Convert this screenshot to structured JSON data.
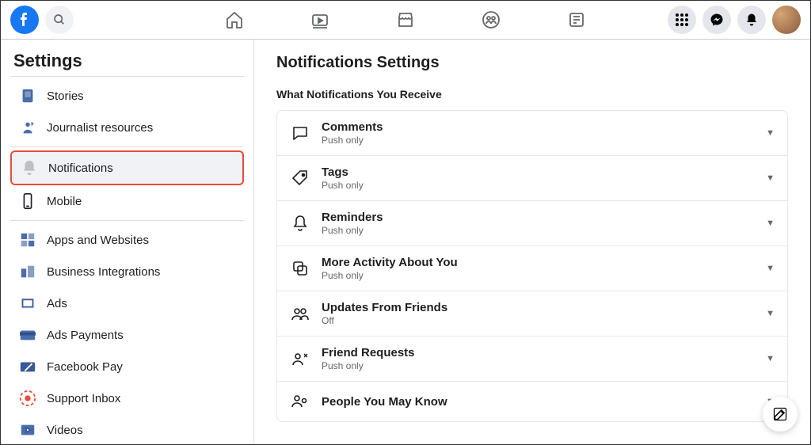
{
  "sidebar": {
    "title": "Settings",
    "items": [
      {
        "label": "Stories",
        "icon": "stories"
      },
      {
        "label": "Journalist resources",
        "icon": "journalist"
      },
      {
        "label": "Notifications",
        "icon": "bell",
        "active": true,
        "highlighted": true
      },
      {
        "label": "Mobile",
        "icon": "phone"
      },
      {
        "label": "Apps and Websites",
        "icon": "apps"
      },
      {
        "label": "Business Integrations",
        "icon": "business"
      },
      {
        "label": "Ads",
        "icon": "ads"
      },
      {
        "label": "Ads Payments",
        "icon": "payments"
      },
      {
        "label": "Facebook Pay",
        "icon": "fbpay"
      },
      {
        "label": "Support Inbox",
        "icon": "support"
      },
      {
        "label": "Videos",
        "icon": "videos"
      }
    ],
    "dividers_after": [
      1,
      3
    ]
  },
  "main": {
    "title": "Notifications Settings",
    "section_label": "What Notifications You Receive",
    "rows": [
      {
        "title": "Comments",
        "sub": "Push only",
        "icon": "comment"
      },
      {
        "title": "Tags",
        "sub": "Push only",
        "icon": "tag"
      },
      {
        "title": "Reminders",
        "sub": "Push only",
        "icon": "reminder-bell"
      },
      {
        "title": "More Activity About You",
        "sub": "Push only",
        "icon": "activity"
      },
      {
        "title": "Updates From Friends",
        "sub": "Off",
        "icon": "friends"
      },
      {
        "title": "Friend Requests",
        "sub": "Push only",
        "icon": "friend-request"
      },
      {
        "title": "People You May Know",
        "sub": "",
        "icon": "people"
      }
    ]
  }
}
